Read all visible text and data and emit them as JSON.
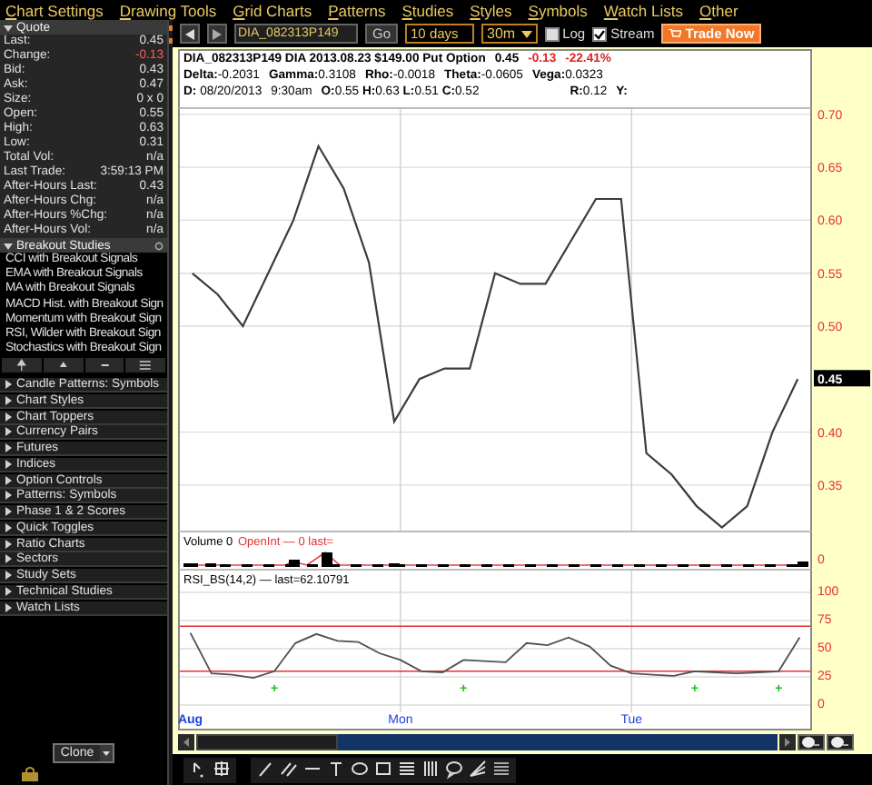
{
  "menu": [
    "Chart Settings",
    "Drawing Tools",
    "Grid Charts",
    "Patterns",
    "Studies",
    "Styles",
    "Symbols",
    "Watch Lists",
    "Other"
  ],
  "quote": {
    "title": "Quote",
    "expanded": true,
    "rows": [
      {
        "label": "Last:",
        "value": "0.45",
        "color": "#e0e0e0"
      },
      {
        "label": "Change:",
        "value": "-0.13",
        "color": "#ff5a5a"
      },
      {
        "label": "Bid:",
        "value": "0.43",
        "color": "#e0e0e0"
      },
      {
        "label": "Ask:",
        "value": "0.47",
        "color": "#e0e0e0"
      },
      {
        "label": "Size:",
        "value": "0 x 0",
        "color": "#e0e0e0"
      },
      {
        "label": "Open:",
        "value": "0.55",
        "color": "#e0e0e0"
      },
      {
        "label": "High:",
        "value": "0.63",
        "color": "#e0e0e0"
      },
      {
        "label": "Low:",
        "value": "0.31",
        "color": "#e0e0e0"
      },
      {
        "label": "Total Vol:",
        "value": "n/a",
        "color": "#e0e0e0"
      },
      {
        "label": "Last Trade:",
        "value": "3:59:13 PM",
        "color": "#e0e0e0"
      },
      {
        "label": "After-Hours Last:",
        "value": "0.43",
        "color": "#e0e0e0"
      },
      {
        "label": "After-Hours Chg:",
        "value": "n/a",
        "color": "#e0e0e0"
      },
      {
        "label": "After-Hours %Chg:",
        "value": "n/a",
        "color": "#e0e0e0"
      },
      {
        "label": "After-Hours Vol:",
        "value": "n/a",
        "color": "#e0e0e0"
      }
    ]
  },
  "studies": {
    "title": "Breakout Studies",
    "expanded": true,
    "items": [
      "CCI with Breakout Signals",
      "EMA with Breakout Signals",
      "MA with Breakout Signals",
      "MACD Hist. with Breakout Sign",
      "Momentum with Breakout Sign",
      "RSI, Wilder with Breakout Sign",
      "Stochastics with Breakout Sign"
    ]
  },
  "groups": [
    {
      "label": "Candle Patterns: Symbols",
      "expanded": false
    },
    {
      "label": "Chart Styles",
      "expanded": false
    },
    {
      "label": "Chart Toppers",
      "expanded": false
    },
    {
      "label": "Currency Pairs",
      "expanded": false
    },
    {
      "label": "Futures",
      "expanded": false
    },
    {
      "label": "Indices",
      "expanded": false
    },
    {
      "label": "Option Controls",
      "expanded": false
    },
    {
      "label": "Patterns: Symbols",
      "expanded": false
    },
    {
      "label": "Phase 1 & 2 Scores",
      "expanded": false
    },
    {
      "label": "Quick Toggles",
      "expanded": false
    },
    {
      "label": "Ratio Charts",
      "expanded": false
    },
    {
      "label": "Sectors",
      "expanded": false
    },
    {
      "label": "Study Sets",
      "expanded": false
    },
    {
      "label": "Technical Studies",
      "expanded": false
    },
    {
      "label": "Watch Lists",
      "expanded": false
    }
  ],
  "clone_button": "Clone",
  "toolbar": {
    "symbol": "DIA_082313P149",
    "go": "Go",
    "range": "10 days",
    "interval": "30m",
    "log": {
      "label": "Log",
      "checked": false
    },
    "stream": {
      "label": "Stream",
      "checked": true
    },
    "trade_button": "Trade Now"
  },
  "chart": {
    "title": "DIA_082313P149 DIA 2013.08.23 $149.00 Put Option",
    "last": "0.45",
    "change": "-0.13",
    "change_pct": "-22.41%",
    "greeks": [
      "**Delta:**-0.2031",
      "**Gamma:**0.3108",
      "**Rho:**-0.0018",
      "**Theta:**-0.0605",
      "**Vega:**0.0323"
    ],
    "bar_info": [
      "**D:** 08/20/2013",
      "9:30am",
      "**O:**0.55 **H:**0.63 **L:**0.51 **C:**0.52"
    ],
    "r": "**R:**0.12",
    "y": "**Y:**",
    "price": {
      "chart_data": {
        "type": "line",
        "grid": true,
        "ylim": [
          0.307,
          0.705
        ],
        "categories": [
          null,
          null,
          null,
          null,
          null,
          null,
          null,
          null,
          null,
          null,
          null,
          null,
          null,
          null,
          null,
          null,
          null,
          null,
          null,
          null,
          null,
          null,
          null,
          null,
          null
        ],
        "yticks": [
          {
            "value": 0.7,
            "label": "0.70"
          },
          {
            "value": 0.65,
            "label": "0.65"
          },
          {
            "value": 0.6,
            "label": "0.60"
          },
          {
            "value": 0.55,
            "label": "0.55"
          },
          {
            "value": 0.5,
            "label": "0.50"
          },
          {
            "value": 0.4,
            "label": "0.40"
          },
          {
            "value": 0.35,
            "label": "0.35"
          }
        ],
        "series": [
          {
            "color": "#3c3c3c",
            "values": [
              0.55,
              0.53,
              0.5,
              0.55,
              0.6,
              0.67,
              0.63,
              0.56,
              0.41,
              0.45,
              0.46,
              0.46,
              0.55,
              0.54,
              0.54,
              0.58,
              0.62,
              0.62,
              0.38,
              0.36,
              0.33,
              0.31,
              0.33,
              0.4,
              0.45
            ]
          }
        ]
      }
    },
    "last_tag": "0.45",
    "volume": {
      "label": "Volume 0",
      "openint": "OpenInt — 0 last=",
      "tick": "0"
    },
    "rsi": {
      "label": "RSI_BS(14,2) — last=62.10791",
      "signals": [
        "+",
        "+",
        "+",
        "+"
      ],
      "chart_data": {
        "type": "line",
        "grid": true,
        "ylim": [
          0,
          100
        ],
        "categories": [
          "Aug",
          null,
          null,
          null,
          null,
          null,
          null,
          null,
          null,
          null,
          "Mon",
          null,
          null,
          null,
          null,
          null,
          null,
          null,
          null,
          null,
          null,
          "Tue",
          null,
          null,
          null,
          null,
          null,
          null,
          null,
          null
        ],
        "yticks": [
          {
            "value": 100,
            "label": "100"
          },
          {
            "value": 75,
            "label": "75"
          },
          {
            "value": 50,
            "label": "50"
          },
          {
            "value": 25,
            "label": "25"
          },
          {
            "value": 0,
            "label": "0"
          }
        ],
        "series": [
          {
            "color": "#505050",
            "values": [
              64,
              28,
              27,
              24,
              30,
              55,
              63,
              57,
              56,
              46,
              40,
              30,
              29,
              40,
              39,
              38,
              55,
              53,
              60,
              52,
              35,
              28,
              27,
              26,
              30,
              29,
              28,
              29,
              30,
              60
            ]
          }
        ],
        "ref_lines": [
          {
            "axis": "y",
            "value": 70
          },
          {
            "axis": "y",
            "value": 30
          }
        ]
      }
    }
  }
}
